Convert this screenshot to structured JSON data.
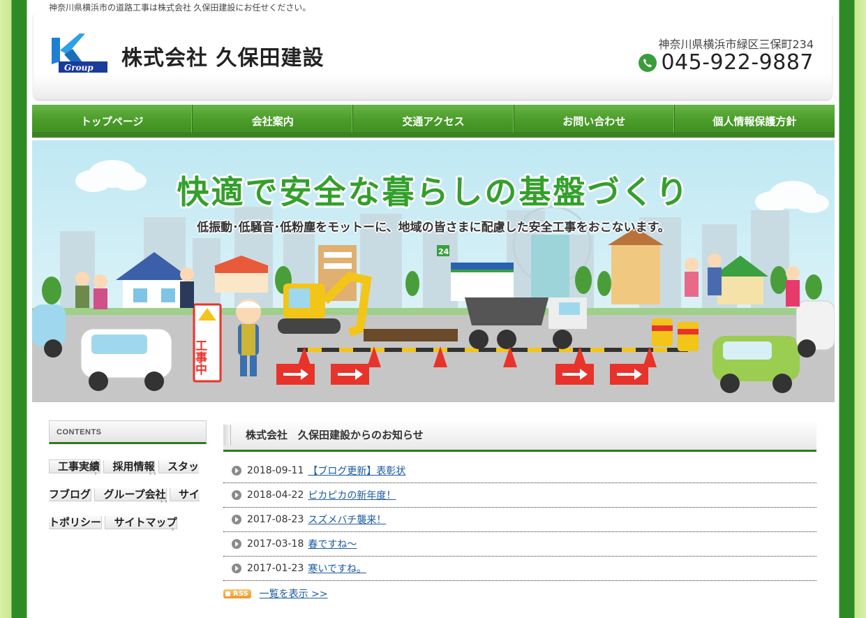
{
  "header": {
    "tagline": "神奈川県横浜市の道路工事は株式会社 久保田建設にお任せください。",
    "company_name": "株式会社 久保田建設",
    "logo_text": "Group",
    "address": "神奈川県横浜市緑区三保町234",
    "phone": "045-922-9887"
  },
  "nav": {
    "items": [
      {
        "label": "トップページ"
      },
      {
        "label": "会社案内"
      },
      {
        "label": "交通アクセス"
      },
      {
        "label": "お問い合わせ"
      },
      {
        "label": "個人情報保護方針"
      }
    ]
  },
  "hero": {
    "title": "快適で安全な暮らしの基盤づくり",
    "subtitle": "低振動･低騒音･低粉塵をモットーに、地域の皆さまに配慮した安全工事をおこないます。",
    "sign_text": "工事中",
    "store_sign": "24"
  },
  "sidebar": {
    "contents_label": "CONTENTS",
    "items": [
      {
        "label": "工事実績"
      },
      {
        "label": "採用情報"
      },
      {
        "label": "スタッフブログ"
      },
      {
        "label": "グループ会社"
      },
      {
        "label": "サイトポリシー"
      },
      {
        "label": "サイトマップ"
      }
    ]
  },
  "news": {
    "title": "株式会社　久保田建設からのお知らせ",
    "items": [
      {
        "date": "2018-09-11",
        "title": "【ブログ更新】表彰状"
      },
      {
        "date": "2018-04-22",
        "title": "ピカピカの新年度！"
      },
      {
        "date": "2017-08-23",
        "title": "スズメバチ襲来！"
      },
      {
        "date": "2017-03-18",
        "title": "春ですね～"
      },
      {
        "date": "2017-01-23",
        "title": "寒いですね。"
      }
    ],
    "rss_label": "RSS",
    "more_label": "一覧を表示 >>"
  },
  "colors": {
    "nav_green": "#4b9d2a",
    "accent_green": "#2f7a20",
    "hero_title": "#33a02c",
    "link": "#1a5aa0"
  }
}
